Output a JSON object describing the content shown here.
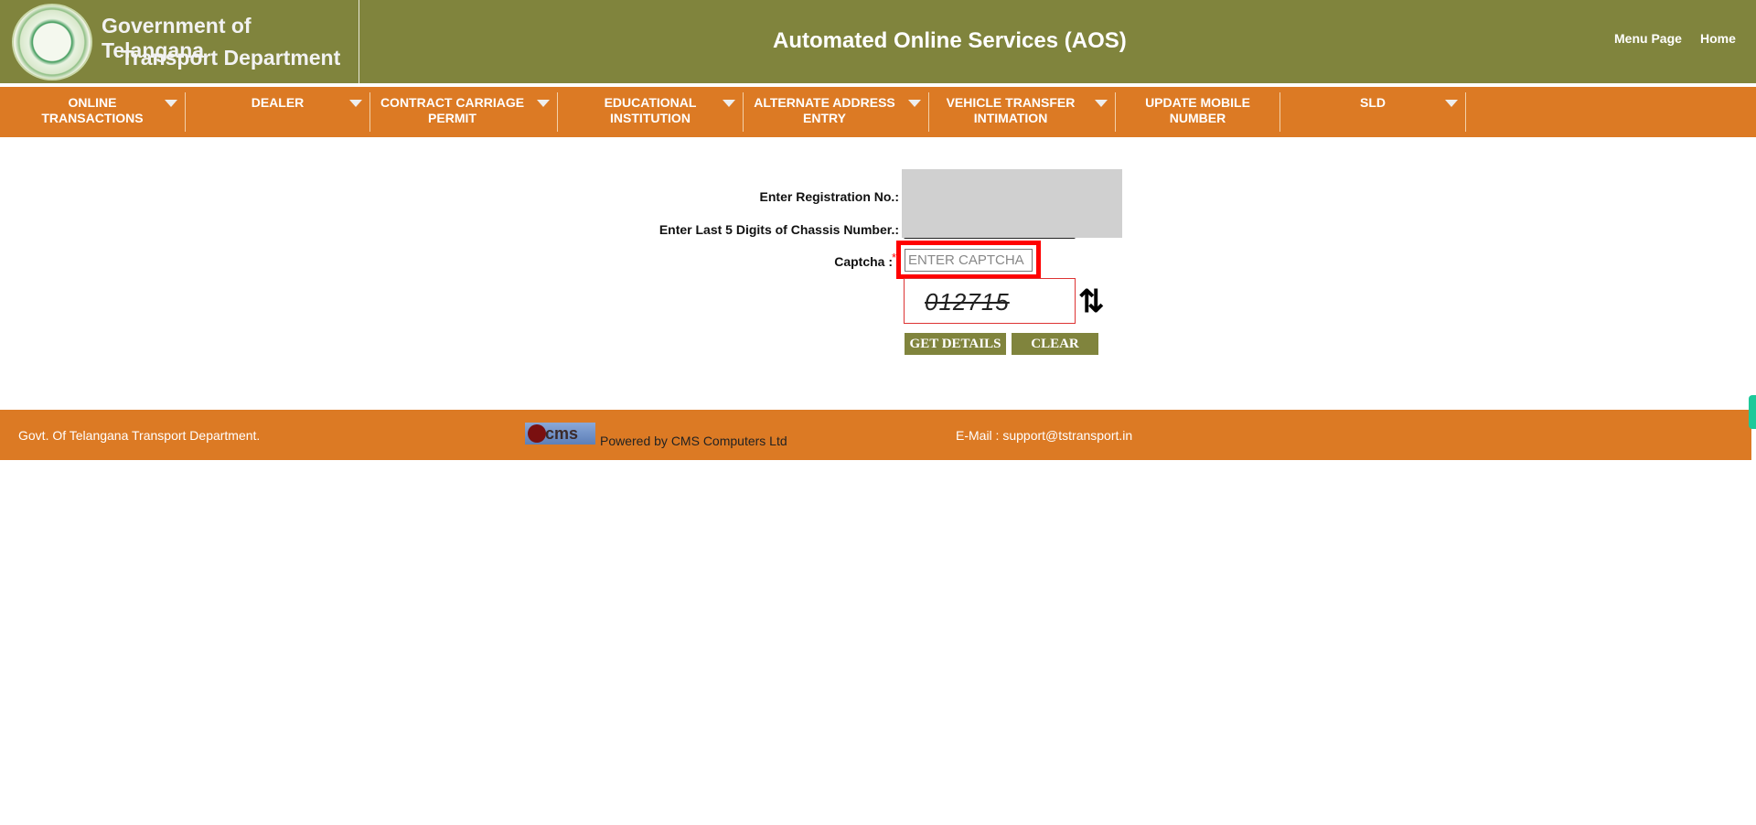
{
  "header": {
    "org_line1": "Government of Telangana",
    "org_line2": "Transport Department",
    "title": "Automated Online Services (AOS)",
    "links": [
      "Menu Page",
      "Home"
    ]
  },
  "nav": {
    "items": [
      {
        "label": "ONLINE TRANSACTIONS",
        "dropdown": true
      },
      {
        "label": "DEALER",
        "dropdown": true
      },
      {
        "label": "CONTRACT CARRIAGE PERMIT",
        "dropdown": true
      },
      {
        "label": "EDUCATIONAL INSTITUTION",
        "dropdown": true
      },
      {
        "label": "ALTERNATE ADDRESS ENTRY",
        "dropdown": true
      },
      {
        "label": "VEHICLE TRANSFER INTIMATION",
        "dropdown": true
      },
      {
        "label": "UPDATE MOBILE NUMBER",
        "dropdown": false
      },
      {
        "label": "SLD",
        "dropdown": true
      }
    ]
  },
  "form": {
    "registration_label": "Enter Registration No.:",
    "chassis_label": "Enter Last 5 Digits of Chassis Number.:",
    "captcha_label": "Captcha :",
    "required_mark": "*",
    "captcha_placeholder": "ENTER CAPTCHA",
    "captcha_value": "012715",
    "get_details": "GET DETAILS",
    "clear": "CLEAR"
  },
  "footer": {
    "left": "Govt. Of Telangana Transport Department.",
    "logo_text": "cms",
    "powered": "Powered by CMS Computers Ltd",
    "email": "E-Mail : support@tstransport.in"
  },
  "colors": {
    "header": "#80843d",
    "nav": "#dc7a24",
    "highlight": "#ff0000"
  }
}
